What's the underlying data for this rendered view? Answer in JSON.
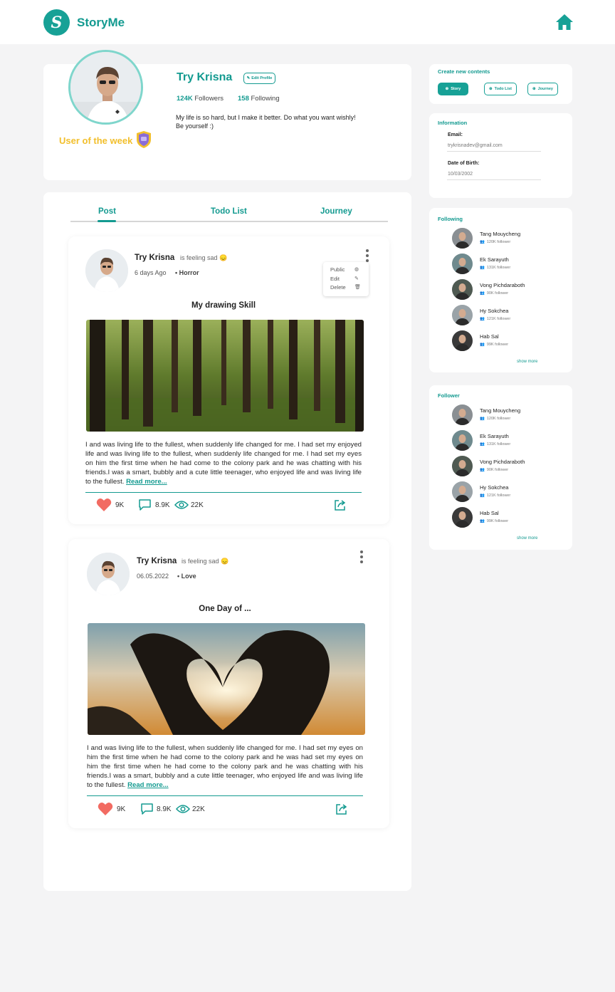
{
  "header": {
    "brand": "StoryMe",
    "logo_letter": "S"
  },
  "profile": {
    "name": "Try Krisna",
    "edit_label": "Edit Profile",
    "followers_count": "124K",
    "followers_label": "Followers",
    "following_count": "158",
    "following_label": "Following",
    "bio": "My life is so hard, but I make it better. Do what you want wishly!  Be yourself :)",
    "badge_label": "User of the week"
  },
  "tabs": [
    {
      "label": "Post",
      "active": true
    },
    {
      "label": "Todo List",
      "active": false
    },
    {
      "label": "Journey",
      "active": false
    }
  ],
  "posts": [
    {
      "user": "Try Krisna",
      "feeling": "is feeling sad 😞",
      "date": "6 days Ago",
      "category": "• Horror",
      "title": "My drawing Skill",
      "body": "I and was living life to the fullest, when suddenly life changed for me. I had set my enjoyed life and was living life to the fullest, when suddenly life changed for me. I had set my eyes on him the first time when he had come to the colony park and he was chatting with his friends.I was a smart, bubbly and  a cute little teenager, who enjoyed life and was living life to the fullest.",
      "read_more": "Read more...",
      "likes": "9K",
      "comments": "8.9K",
      "views": "22K"
    },
    {
      "user": "Try Krisna",
      "feeling": "is feeling sad 😞",
      "date": "06.05.2022",
      "category": "• Love",
      "title": "One Day of ...",
      "body": "I and was living life to the fullest, when suddenly life changed for me. I had set my eyes on him the first time when he had come to the colony park and he was had set my eyes on him the first time when he had come to the colony park and he was chatting with his friends.I was a smart, bubbly and  a cute little teenager, who enjoyed life and was living life to the fullest.",
      "read_more": "Read more...",
      "likes": "9K",
      "comments": "8.9K",
      "views": "22K"
    }
  ],
  "post_menu": {
    "public": "Public",
    "edit": "Edit",
    "delete": "Delete"
  },
  "create": {
    "title": "Create new contents",
    "story": "Story",
    "todo": "Todo List",
    "journey": "Journey"
  },
  "info": {
    "title": "Information",
    "email_label": "Email:",
    "email": "trykrisnadev@gmail.com",
    "dob_label": "Date of Birth:",
    "dob": "10/03/2002"
  },
  "following": {
    "title": "Following",
    "show_more": "show more",
    "people": [
      {
        "name": "Tang Mouycheng",
        "followers": "120K follower"
      },
      {
        "name": "Ek Sarayuth",
        "followers": "131K follower"
      },
      {
        "name": "Vong Pichdaraboth",
        "followers": "90K follower"
      },
      {
        "name": "Hy Sokchea",
        "followers": "121K follower"
      },
      {
        "name": "Hab Sal",
        "followers": "99K follower"
      }
    ]
  },
  "follower": {
    "title": "Follower",
    "show_more": "show more",
    "people": [
      {
        "name": "Tang Mouycheng",
        "followers": "120K follower"
      },
      {
        "name": "Ek Sarayuth",
        "followers": "131K follower"
      },
      {
        "name": "Vong Pichdaraboth",
        "followers": "90K follower"
      },
      {
        "name": "Hy Sokchea",
        "followers": "121K follower"
      },
      {
        "name": "Hab Sal",
        "followers": "99K follower"
      }
    ]
  },
  "colors": {
    "accent": "#139a90",
    "gold": "#f2bf2c",
    "like": "#f26b62"
  }
}
